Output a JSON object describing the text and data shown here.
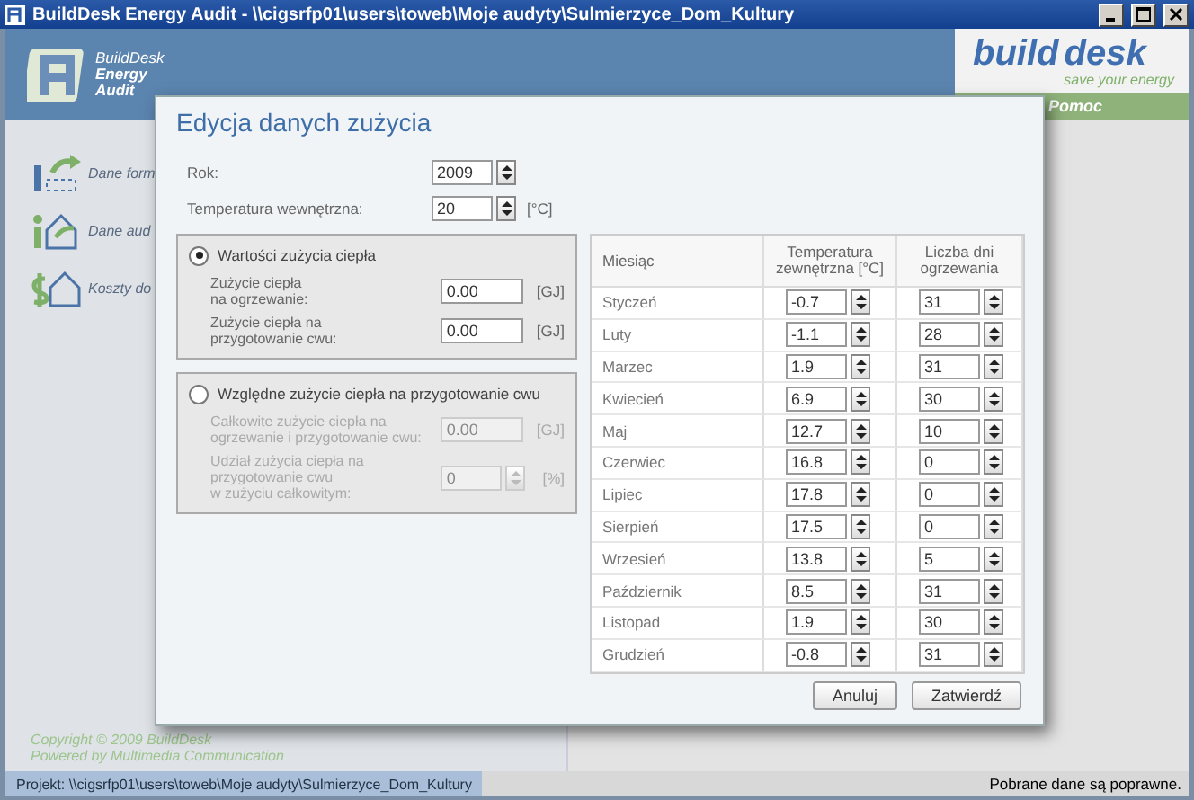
{
  "window": {
    "title": "BuildDesk Energy Audit - \\\\cigsrfp01\\users\\toweb\\Moje audyty\\Sulmierzyce_Dom_Kultury"
  },
  "header": {
    "logo_lines": [
      "BuildDesk",
      "Energy",
      "Audit"
    ],
    "brand": [
      "build",
      "desk"
    ],
    "tagline": "save your energy",
    "help": "Pomoc"
  },
  "sidebar": {
    "items": [
      {
        "label": "Dane form",
        "kind": "form"
      },
      {
        "label": "Dane aud",
        "kind": "audit"
      },
      {
        "label": "Koszty do",
        "kind": "costs"
      }
    ]
  },
  "footer": {
    "copyright": "Copyright © 2009 BuildDesk",
    "powered": "Powered by Multimedia Communication"
  },
  "status_bar": {
    "project": "Projekt:  \\\\cigsrfp01\\users\\toweb\\Moje audyty\\Sulmierzyce_Dom_Kultury",
    "message": "Pobrane dane są poprawne."
  },
  "dialog": {
    "title": "Edycja danych zużycia",
    "fields": [
      {
        "label": "Rok:",
        "value": "2009"
      },
      {
        "label": "Temperatura wewnętrzna:",
        "value": "20",
        "unit": "[°C]"
      }
    ],
    "groups": [
      {
        "label": "Wartości zużycia ciepła",
        "selected": true,
        "fields": [
          {
            "label": "Zużycie ciepła\nna ogrzewanie:",
            "value": "0.00",
            "unit": "[GJ]",
            "kind": "text",
            "disabled": false
          },
          {
            "label": "Zużycie ciepła na\nprzygotowanie cwu:",
            "value": "0.00",
            "unit": "[GJ]",
            "kind": "text",
            "disabled": false
          }
        ]
      },
      {
        "label": "Względne zużycie ciepła na przygotowanie cwu",
        "selected": false,
        "fields": [
          {
            "label": "Całkowite zużycie ciepła na\nogrzewanie i przygotowanie cwu:",
            "value": "0.00",
            "unit": "[GJ]",
            "kind": "text",
            "disabled": true
          },
          {
            "label": "Udział zużycia ciepła na\nprzygotowanie cwu\nw zużyciu całkowitym:",
            "value": "0",
            "unit": "[%]",
            "kind": "spin",
            "disabled": true
          }
        ]
      }
    ],
    "table": {
      "columns": [
        "Miesiąc",
        "Temperatura\nzewnętrzna [°C]",
        "Liczba dni\nogrzewania"
      ],
      "rows": [
        {
          "month": "Styczeń",
          "temperature": "-0.7",
          "days": "31"
        },
        {
          "month": "Luty",
          "temperature": "-1.1",
          "days": "28"
        },
        {
          "month": "Marzec",
          "temperature": "1.9",
          "days": "31"
        },
        {
          "month": "Kwiecień",
          "temperature": "6.9",
          "days": "30"
        },
        {
          "month": "Maj",
          "temperature": "12.7",
          "days": "10"
        },
        {
          "month": "Czerwiec",
          "temperature": "16.8",
          "days": "0"
        },
        {
          "month": "Lipiec",
          "temperature": "17.8",
          "days": "0"
        },
        {
          "month": "Sierpień",
          "temperature": "17.5",
          "days": "0"
        },
        {
          "month": "Wrzesień",
          "temperature": "13.8",
          "days": "5"
        },
        {
          "month": "Październik",
          "temperature": "8.5",
          "days": "31"
        },
        {
          "month": "Listopad",
          "temperature": "1.9",
          "days": "30"
        },
        {
          "month": "Grudzień",
          "temperature": "-0.8",
          "days": "31"
        }
      ]
    },
    "buttons": [
      "Anuluj",
      "Zatwierdź"
    ]
  }
}
